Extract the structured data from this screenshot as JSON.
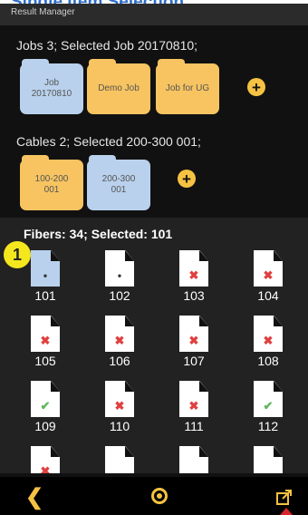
{
  "top_heading": "Single Item Selection",
  "appbar": {
    "title": "Result Manager"
  },
  "jobs": {
    "label": "Jobs 3; Selected Job 20170810;",
    "items": [
      {
        "label": "Job\n20170810",
        "color": "#b9d1ec",
        "selected": true
      },
      {
        "label": "Demo Job",
        "color": "#f7c461",
        "selected": false
      },
      {
        "label": "Job for UG",
        "color": "#f7c461",
        "selected": false
      }
    ],
    "add_label": "+"
  },
  "cables": {
    "label": "Cables 2; Selected 200-300 001;",
    "items": [
      {
        "label": "100-200\n001",
        "color": "#f7c461",
        "selected": false
      },
      {
        "label": "200-300\n001",
        "color": "#b9d1ec",
        "selected": true
      }
    ],
    "add_label": "+"
  },
  "fibers": {
    "label": "Fibers: 34; Selected: 101",
    "items": [
      {
        "number": "101",
        "status": "dot",
        "selected": true
      },
      {
        "number": "102",
        "status": "dot",
        "selected": false
      },
      {
        "number": "103",
        "status": "x",
        "selected": false
      },
      {
        "number": "104",
        "status": "x",
        "selected": false
      },
      {
        "number": "105",
        "status": "x",
        "selected": false
      },
      {
        "number": "106",
        "status": "x",
        "selected": false
      },
      {
        "number": "107",
        "status": "x",
        "selected": false
      },
      {
        "number": "108",
        "status": "x",
        "selected": false
      },
      {
        "number": "109",
        "status": "check",
        "selected": false
      },
      {
        "number": "110",
        "status": "x",
        "selected": false
      },
      {
        "number": "111",
        "status": "x",
        "selected": false
      },
      {
        "number": "112",
        "status": "check",
        "selected": false
      },
      {
        "number": "",
        "status": "x",
        "selected": false
      },
      {
        "number": "",
        "status": "none",
        "selected": false
      },
      {
        "number": "",
        "status": "none",
        "selected": false
      },
      {
        "number": "",
        "status": "none",
        "selected": false
      }
    ]
  },
  "callout_badge": "1",
  "colors": {
    "accent": "#f5c242",
    "selected_blue": "#b9d1ec",
    "folder_orange": "#f7c461"
  },
  "icons": {
    "back": "chevron-left-icon",
    "home": "circle-dot-icon",
    "export": "export-icon"
  }
}
